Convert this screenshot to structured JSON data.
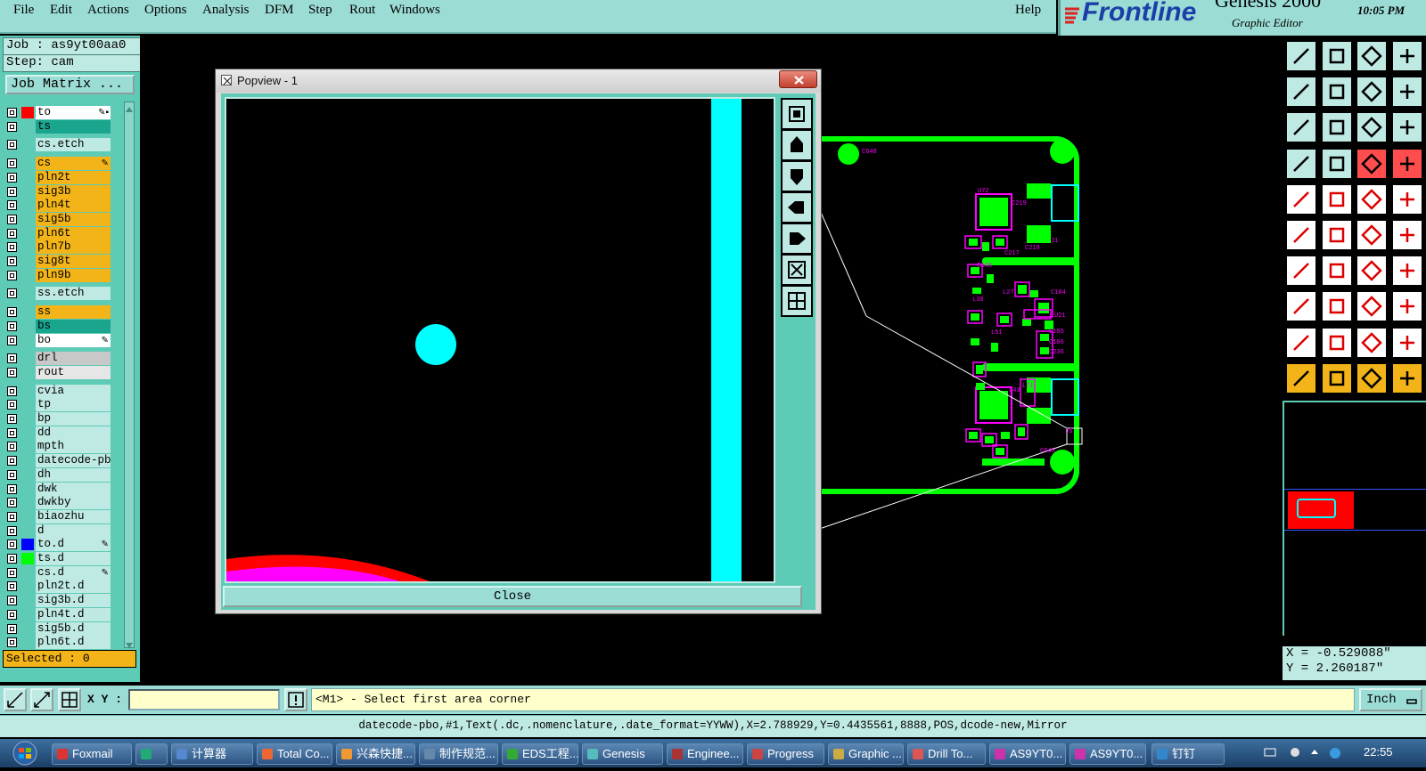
{
  "menu": [
    "File",
    "Edit",
    "Actions",
    "Options",
    "Analysis",
    "DFM",
    "Step",
    "Rout",
    "Windows"
  ],
  "help": "Help",
  "brand": {
    "logo": "Frontline",
    "product": "Genesis 2000",
    "subtitle": "Graphic Editor",
    "time": "10:05 PM"
  },
  "job": "Job : as9yt00aa0",
  "step": "Step: cam",
  "job_matrix_button": "Job Matrix ...",
  "layers": [
    {
      "name": "to",
      "color": "#ffffff",
      "swatch": "#ff0000",
      "mark": "✎▪"
    },
    {
      "name": "ts",
      "color": "#1aa58f",
      "swatch": "",
      "mark": ""
    },
    {
      "name": "cs.etch",
      "color": "#bfe9e3",
      "swatch": "",
      "mark": ""
    },
    {
      "name": "cs",
      "color": "#f2b418",
      "swatch": "",
      "mark": "✎"
    },
    {
      "name": "pln2t",
      "color": "#f2b418",
      "swatch": "",
      "mark": ""
    },
    {
      "name": "sig3b",
      "color": "#f2b418",
      "swatch": "",
      "mark": ""
    },
    {
      "name": "pln4t",
      "color": "#f2b418",
      "swatch": "",
      "mark": ""
    },
    {
      "name": "sig5b",
      "color": "#f2b418",
      "swatch": "",
      "mark": ""
    },
    {
      "name": "pln6t",
      "color": "#f2b418",
      "swatch": "",
      "mark": ""
    },
    {
      "name": "pln7b",
      "color": "#f2b418",
      "swatch": "",
      "mark": ""
    },
    {
      "name": "sig8t",
      "color": "#f2b418",
      "swatch": "",
      "mark": ""
    },
    {
      "name": "pln9b",
      "color": "#f2b418",
      "swatch": "",
      "mark": ""
    },
    {
      "name": "ss.etch",
      "color": "#bfe9e3",
      "swatch": "",
      "mark": ""
    },
    {
      "name": "ss",
      "color": "#f2b418",
      "swatch": "",
      "mark": ""
    },
    {
      "name": "bs",
      "color": "#1aa58f",
      "swatch": "",
      "mark": ""
    },
    {
      "name": "bo",
      "color": "#ffffff",
      "swatch": "",
      "mark": "✎"
    },
    {
      "name": "drl",
      "color": "#c8c8c8",
      "swatch": "",
      "mark": ""
    },
    {
      "name": "rout",
      "color": "#e6e6e6",
      "swatch": "",
      "mark": ""
    },
    {
      "name": "cvia",
      "color": "#bfe9e3",
      "swatch": "",
      "mark": ""
    },
    {
      "name": "tp",
      "color": "#bfe9e3",
      "swatch": "",
      "mark": ""
    },
    {
      "name": "bp",
      "color": "#bfe9e3",
      "swatch": "",
      "mark": ""
    },
    {
      "name": "dd",
      "color": "#bfe9e3",
      "swatch": "",
      "mark": ""
    },
    {
      "name": "mpth",
      "color": "#bfe9e3",
      "swatch": "",
      "mark": ""
    },
    {
      "name": "datecode-pbo",
      "color": "#bfe9e3",
      "swatch": "",
      "mark": ""
    },
    {
      "name": "dh",
      "color": "#bfe9e3",
      "swatch": "",
      "mark": ""
    },
    {
      "name": "dwk",
      "color": "#bfe9e3",
      "swatch": "",
      "mark": ""
    },
    {
      "name": "dwkby",
      "color": "#bfe9e3",
      "swatch": "",
      "mark": ""
    },
    {
      "name": "biaozhu",
      "color": "#bfe9e3",
      "swatch": "",
      "mark": ""
    },
    {
      "name": "d",
      "color": "#bfe9e3",
      "swatch": "",
      "mark": ""
    },
    {
      "name": "to.d",
      "color": "#bfe9e3",
      "swatch": "#0000ff",
      "mark": "✎"
    },
    {
      "name": "ts.d",
      "color": "#bfe9e3",
      "swatch": "#00ff00",
      "mark": ""
    },
    {
      "name": "cs.d",
      "color": "#bfe9e3",
      "swatch": "",
      "mark": "✎"
    },
    {
      "name": "pln2t.d",
      "color": "#bfe9e3",
      "swatch": "",
      "mark": ""
    },
    {
      "name": "sig3b.d",
      "color": "#bfe9e3",
      "swatch": "",
      "mark": ""
    },
    {
      "name": "pln4t.d",
      "color": "#bfe9e3",
      "swatch": "",
      "mark": ""
    },
    {
      "name": "sig5b.d",
      "color": "#bfe9e3",
      "swatch": "",
      "mark": ""
    },
    {
      "name": "pln6t.d",
      "color": "#bfe9e3",
      "swatch": "",
      "mark": ""
    }
  ],
  "selected": "Selected : 0",
  "popview": {
    "title": "Popview - 1",
    "close_label": "Close"
  },
  "pcb_labels": [
    "C648",
    "U72",
    "C219",
    "J1",
    "C218",
    "C217",
    "C648",
    "L30",
    "L27",
    "C104",
    "U21",
    "L51",
    "C105",
    "C106",
    "C236",
    "L43",
    "L71",
    "J5",
    "C845"
  ],
  "coords": {
    "x": "X = -0.529088\"",
    "y": "Y =  2.260187\""
  },
  "cmd": {
    "xy_label": "X Y :",
    "xy_value": "",
    "prompt": "<M1> - Select first area corner",
    "units": "Inch"
  },
  "status": "datecode-pbo,#1,Text(.dc,.nomenclature,.date_format=YYWW),X=2.788929,Y=0.4435561,8888,POS,dcode-new,Mirror",
  "taskbar": {
    "items": [
      "Foxmail",
      "",
      "计算器",
      "Total Co...",
      "兴森快捷...",
      "制作规范...",
      "EDS工程...",
      "Genesis",
      "Enginee...",
      "Progress",
      "Graphic ...",
      "Drill To...",
      "AS9YT0...",
      "AS9YT0...",
      "钉钉"
    ],
    "clock": "22:55"
  },
  "colors": {
    "panel": "#5ecbb6",
    "menu": "#9bdcd4",
    "pad_cyan": "#00ffff",
    "trace_green": "#00ff00",
    "silk_magenta": "#ff00ff"
  }
}
